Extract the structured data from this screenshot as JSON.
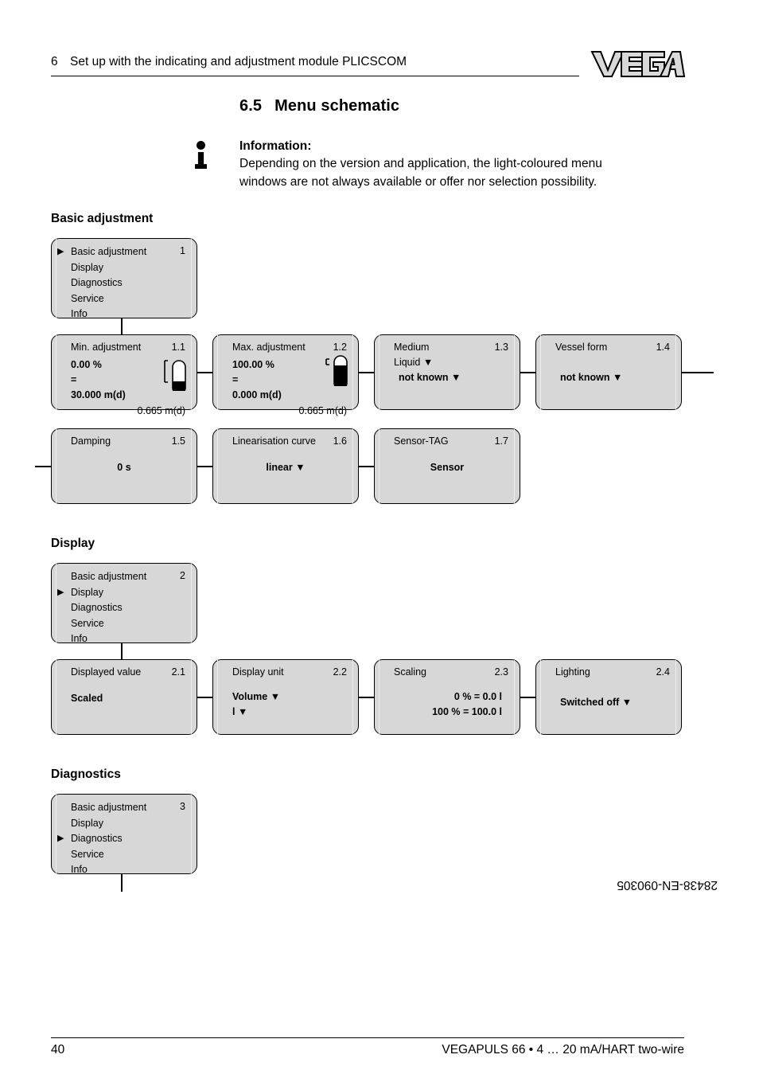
{
  "header": {
    "chapter_number": "6",
    "chapter_title": "Set up with the indicating and adjustment module PLICSCOM",
    "logo_text": "VEGA"
  },
  "section": {
    "number": "6.5",
    "title": "Menu schematic"
  },
  "info": {
    "icon": "information-icon",
    "title": "Information:",
    "line1": "Depending on the version and application, the light-coloured menu",
    "line2": "windows are not always available or offer nor selection possibility."
  },
  "groups": {
    "basic": "Basic adjustment",
    "display": "Display",
    "diagnostics": "Diagnostics"
  },
  "menu_basic": {
    "number": "1",
    "items": [
      {
        "label": "Basic adjustment",
        "selected": true
      },
      {
        "label": "Display",
        "selected": false
      },
      {
        "label": "Diagnostics",
        "selected": false
      },
      {
        "label": "Service",
        "selected": false
      },
      {
        "label": "Info",
        "selected": false
      }
    ],
    "marker": "▶"
  },
  "menu_display": {
    "number": "2",
    "items": [
      {
        "label": "Basic adjustment",
        "selected": false
      },
      {
        "label": "Display",
        "selected": true
      },
      {
        "label": "Diagnostics",
        "selected": false
      },
      {
        "label": "Service",
        "selected": false
      },
      {
        "label": "Info",
        "selected": false
      }
    ],
    "marker": "▶"
  },
  "menu_diagnostics": {
    "number": "3",
    "items": [
      {
        "label": "Basic adjustment",
        "selected": false
      },
      {
        "label": "Display",
        "selected": false
      },
      {
        "label": "Diagnostics",
        "selected": true
      },
      {
        "label": "Service",
        "selected": false
      },
      {
        "label": "Info",
        "selected": false
      }
    ],
    "marker": "▶"
  },
  "boxes": {
    "b11": {
      "title": "Min. adjustment",
      "number": "1.1",
      "percent": "0.00 %",
      "equals": "=",
      "distance": "30.000 m(d)",
      "measured": "0.665 m(d)",
      "icon": "tank-empty-icon"
    },
    "b12": {
      "title": "Max. adjustment",
      "number": "1.2",
      "percent": "100.00 %",
      "equals": "=",
      "distance": "0.000 m(d)",
      "measured": "0.665 m(d)",
      "icon": "tank-full-icon"
    },
    "b13": {
      "title": "Medium",
      "number": "1.3",
      "value1": "Liquid ▼",
      "value2": "not known ▼"
    },
    "b14": {
      "title": "Vessel form",
      "number": "1.4",
      "value1": "not known ▼"
    },
    "b15": {
      "title": "Damping",
      "number": "1.5",
      "value1": "0 s"
    },
    "b16": {
      "title": "Linearisation curve",
      "number": "1.6",
      "value1": "linear ▼"
    },
    "b17": {
      "title": "Sensor-TAG",
      "number": "1.7",
      "value1": "Sensor"
    },
    "b21": {
      "title": "Displayed value",
      "number": "2.1",
      "value1": "Scaled"
    },
    "b22": {
      "title": "Display unit",
      "number": "2.2",
      "value1": "Volume ▼",
      "value2": "l ▼"
    },
    "b23": {
      "title": "Scaling",
      "number": "2.3",
      "value1": "0 % = 0.0 l",
      "value2": "100 % = 100.0 l"
    },
    "b24": {
      "title": "Lighting",
      "number": "2.4",
      "value1": "Switched off ▼"
    }
  },
  "footer": {
    "page_number": "40",
    "product": "VEGAPULS 66 • 4 … 20 mA/HART two-wire",
    "doc_id": "28438-EN-090305"
  }
}
